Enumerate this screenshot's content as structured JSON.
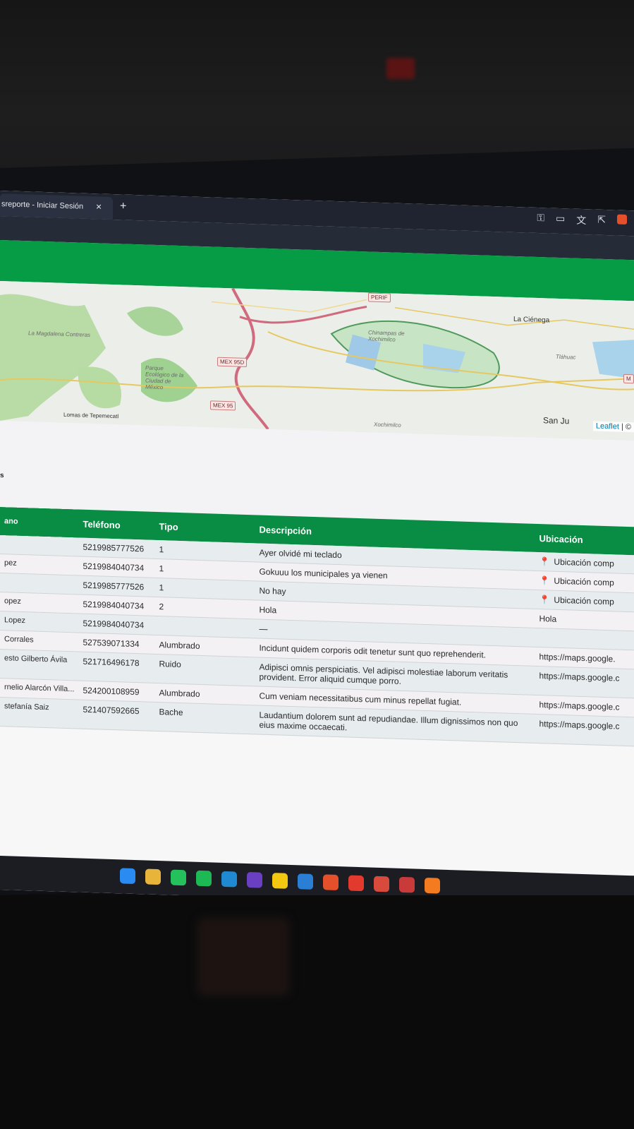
{
  "browser": {
    "tab_title": "sreporte - Iniciar Sesión",
    "tab_close": "×",
    "tab_new": "+",
    "toolbar_icons": [
      "key-icon",
      "cast-icon",
      "translate-icon",
      "share-icon",
      "brave-shield-icon"
    ]
  },
  "map": {
    "places": {
      "magdalena": "La Magdalena Contreras",
      "parque": "Parque Ecológico de la Ciudad de México",
      "lomas": "Lomas de Tepemecatl",
      "chinampas": "Chinampas de Xochimilco",
      "xochimilco": "Xochimilco",
      "cienega": "La Ciénega",
      "tlahuac": "Tláhuac",
      "san_juan": "San Ju"
    },
    "roads": {
      "perif": "PERIF",
      "mex95d": "MEX 95D",
      "mex95": "MEX 95",
      "m": "M"
    },
    "attribution_link": "Leaflet",
    "attribution_rest": "| ©"
  },
  "section_fragment": "s",
  "table": {
    "headers": {
      "name": "ano",
      "telefono": "Teléfono",
      "tipo": "Tipo",
      "descripcion": "Descripción",
      "ubicacion": "Ubicación"
    },
    "rows": [
      {
        "name": "",
        "telefono": "5219985777526",
        "tipo": "1",
        "descripcion": "Ayer olvidé mi teclado",
        "ubicacion": "Ubicación comp",
        "pin": true
      },
      {
        "name": "pez",
        "telefono": "5219984040734",
        "tipo": "1",
        "descripcion": "Gokuuu los municipales ya vienen",
        "ubicacion": "Ubicación comp",
        "pin": true
      },
      {
        "name": "",
        "telefono": "5219985777526",
        "tipo": "1",
        "descripcion": "No hay",
        "ubicacion": "Ubicación comp",
        "pin": true
      },
      {
        "name": "opez",
        "telefono": "5219984040734",
        "tipo": "2",
        "descripcion": "Hola",
        "ubicacion": "Hola",
        "pin": false
      },
      {
        "name": "Lopez",
        "telefono": "5219984040734",
        "tipo": "",
        "descripcion": "—",
        "ubicacion": "",
        "pin": false
      },
      {
        "name": "Corrales",
        "telefono": "527539071334",
        "tipo": "Alumbrado",
        "descripcion": "Incidunt quidem corporis odit tenetur sunt quo reprehenderit.",
        "ubicacion": "https://maps.google.",
        "pin": false
      },
      {
        "name": "esto Gilberto Ávila",
        "telefono": "521716496178",
        "tipo": "Ruido",
        "descripcion": "Adipisci omnis perspiciatis. Vel adipisci molestiae laborum veritatis provident. Error aliquid cumque porro.",
        "ubicacion": "https://maps.google.c",
        "pin": false
      },
      {
        "name": "rnelio Alarcón Villa...",
        "telefono": "524200108959",
        "tipo": "Alumbrado",
        "descripcion": "Cum veniam necessitatibus cum minus repellat fugiat.",
        "ubicacion": "https://maps.google.c",
        "pin": false
      },
      {
        "name": "stefanía Saiz",
        "telefono": "521407592665",
        "tipo": "Bache",
        "descripcion": "Laudantium dolorem sunt ad repudiandae. Illum dignissimos non quo eius maxime occaecati.",
        "ubicacion": "https://maps.google.c",
        "pin": false
      }
    ]
  },
  "taskbar": {
    "apps": [
      {
        "icon": "windows-start-icon",
        "color": "#2a8bf2"
      },
      {
        "icon": "file-explorer-icon",
        "color": "#e9b43a"
      },
      {
        "icon": "whatsapp-icon",
        "color": "#25c15d"
      },
      {
        "icon": "spotify-icon",
        "color": "#1db954"
      },
      {
        "icon": "edge-icon",
        "color": "#1f8ad2"
      },
      {
        "icon": "github-icon",
        "color": "#6a3fc1"
      },
      {
        "icon": "power-bi-icon",
        "color": "#f2c811"
      },
      {
        "icon": "vscode-icon",
        "color": "#2a7fd4"
      },
      {
        "icon": "brave-icon",
        "color": "#e4502a"
      },
      {
        "icon": "anydesk-icon",
        "color": "#e23b2e"
      },
      {
        "icon": "app-1-icon",
        "color": "#d84a3b"
      },
      {
        "icon": "app-2-icon",
        "color": "#c93a3a"
      },
      {
        "icon": "xampp-icon",
        "color": "#f47b20"
      }
    ]
  }
}
